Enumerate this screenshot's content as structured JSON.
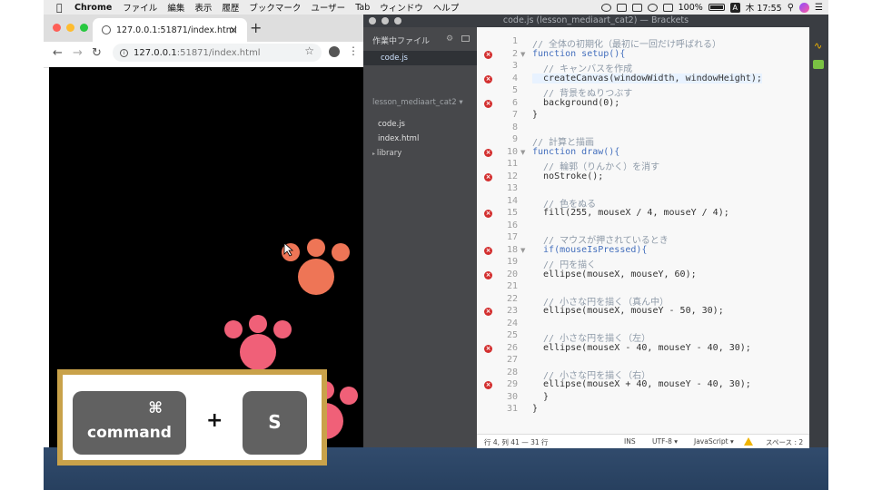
{
  "menubar": {
    "app": "Chrome",
    "items": [
      "ファイル",
      "編集",
      "表示",
      "履歴",
      "ブックマーク",
      "ユーザー",
      "Tab",
      "ウィンドウ",
      "ヘルプ"
    ],
    "battery": "100%",
    "a_badge": "A",
    "clock": "木 17:55"
  },
  "chrome": {
    "tab_title": "127.0.0.1:51871/index.html",
    "url_host": "127.0.0.1",
    "url_rest": ":51871/index.html"
  },
  "brackets": {
    "window_title": "code.js (lesson_mediaart_cat2) — Brackets",
    "sidebar": {
      "working_files_header": "作業中ファイル",
      "working_file": "code.js",
      "project_name": "lesson_mediaart_cat2",
      "files": [
        "code.js",
        "index.html"
      ],
      "folder": "library"
    },
    "code_lines": [
      {
        "n": "1",
        "text": "// 全体の初期化（最初に一回だけ呼ばれる）",
        "err": false,
        "fold": false
      },
      {
        "n": "2",
        "text": "function setup(){",
        "err": true,
        "fold": true
      },
      {
        "n": "3",
        "text": "  // キャンバスを作成",
        "err": false,
        "fold": false
      },
      {
        "n": "4",
        "text": "  createCanvas(windowWidth, windowHeight);",
        "err": true,
        "fold": false
      },
      {
        "n": "5",
        "text": "  // 背景をぬりつぶす",
        "err": false,
        "fold": false
      },
      {
        "n": "6",
        "text": "  background(0);",
        "err": true,
        "fold": false
      },
      {
        "n": "7",
        "text": "}",
        "err": false,
        "fold": false
      },
      {
        "n": "8",
        "text": "",
        "err": false,
        "fold": false
      },
      {
        "n": "9",
        "text": "// 計算と描画",
        "err": false,
        "fold": false
      },
      {
        "n": "10",
        "text": "function draw(){",
        "err": true,
        "fold": true
      },
      {
        "n": "11",
        "text": "  // 輪郭（りんかく）を消す",
        "err": false,
        "fold": false
      },
      {
        "n": "12",
        "text": "  noStroke();",
        "err": true,
        "fold": false
      },
      {
        "n": "13",
        "text": "",
        "err": false,
        "fold": false
      },
      {
        "n": "14",
        "text": "  // 色をぬる",
        "err": false,
        "fold": false
      },
      {
        "n": "15",
        "text": "  fill(255, mouseX / 4, mouseY / 4);",
        "err": true,
        "fold": false
      },
      {
        "n": "16",
        "text": "",
        "err": false,
        "fold": false
      },
      {
        "n": "17",
        "text": "  // マウスが押されているとき",
        "err": false,
        "fold": false
      },
      {
        "n": "18",
        "text": "  if(mouseIsPressed){",
        "err": true,
        "fold": true
      },
      {
        "n": "19",
        "text": "  // 円を描く",
        "err": false,
        "fold": false
      },
      {
        "n": "20",
        "text": "  ellipse(mouseX, mouseY, 60);",
        "err": true,
        "fold": false
      },
      {
        "n": "21",
        "text": "",
        "err": false,
        "fold": false
      },
      {
        "n": "22",
        "text": "  // 小さな円を描く（真ん中）",
        "err": false,
        "fold": false
      },
      {
        "n": "23",
        "text": "  ellipse(mouseX, mouseY - 50, 30);",
        "err": true,
        "fold": false
      },
      {
        "n": "24",
        "text": "",
        "err": false,
        "fold": false
      },
      {
        "n": "25",
        "text": "  // 小さな円を描く（左）",
        "err": false,
        "fold": false
      },
      {
        "n": "26",
        "text": "  ellipse(mouseX - 40, mouseY - 40, 30);",
        "err": true,
        "fold": false
      },
      {
        "n": "27",
        "text": "",
        "err": false,
        "fold": false
      },
      {
        "n": "28",
        "text": "  // 小さな円を描く（右）",
        "err": false,
        "fold": false
      },
      {
        "n": "29",
        "text": "  ellipse(mouseX + 40, mouseY - 40, 30);",
        "err": true,
        "fold": false
      },
      {
        "n": "30",
        "text": "  }",
        "err": false,
        "fold": false
      },
      {
        "n": "31",
        "text": "}",
        "err": false,
        "fold": false
      }
    ],
    "status": {
      "position": "行 4, 列 41 — 31 行",
      "mode": "INS",
      "encoding": "UTF-8 ▾",
      "language": "JavaScript ▾",
      "spaces": "スペース : 2"
    }
  },
  "keys": {
    "command_glyph": "⌘",
    "command_label": "command",
    "plus": "+",
    "s_label": "S"
  },
  "colors": {
    "paw_orange": "#ee7556",
    "paw_pink": "#f06078"
  }
}
